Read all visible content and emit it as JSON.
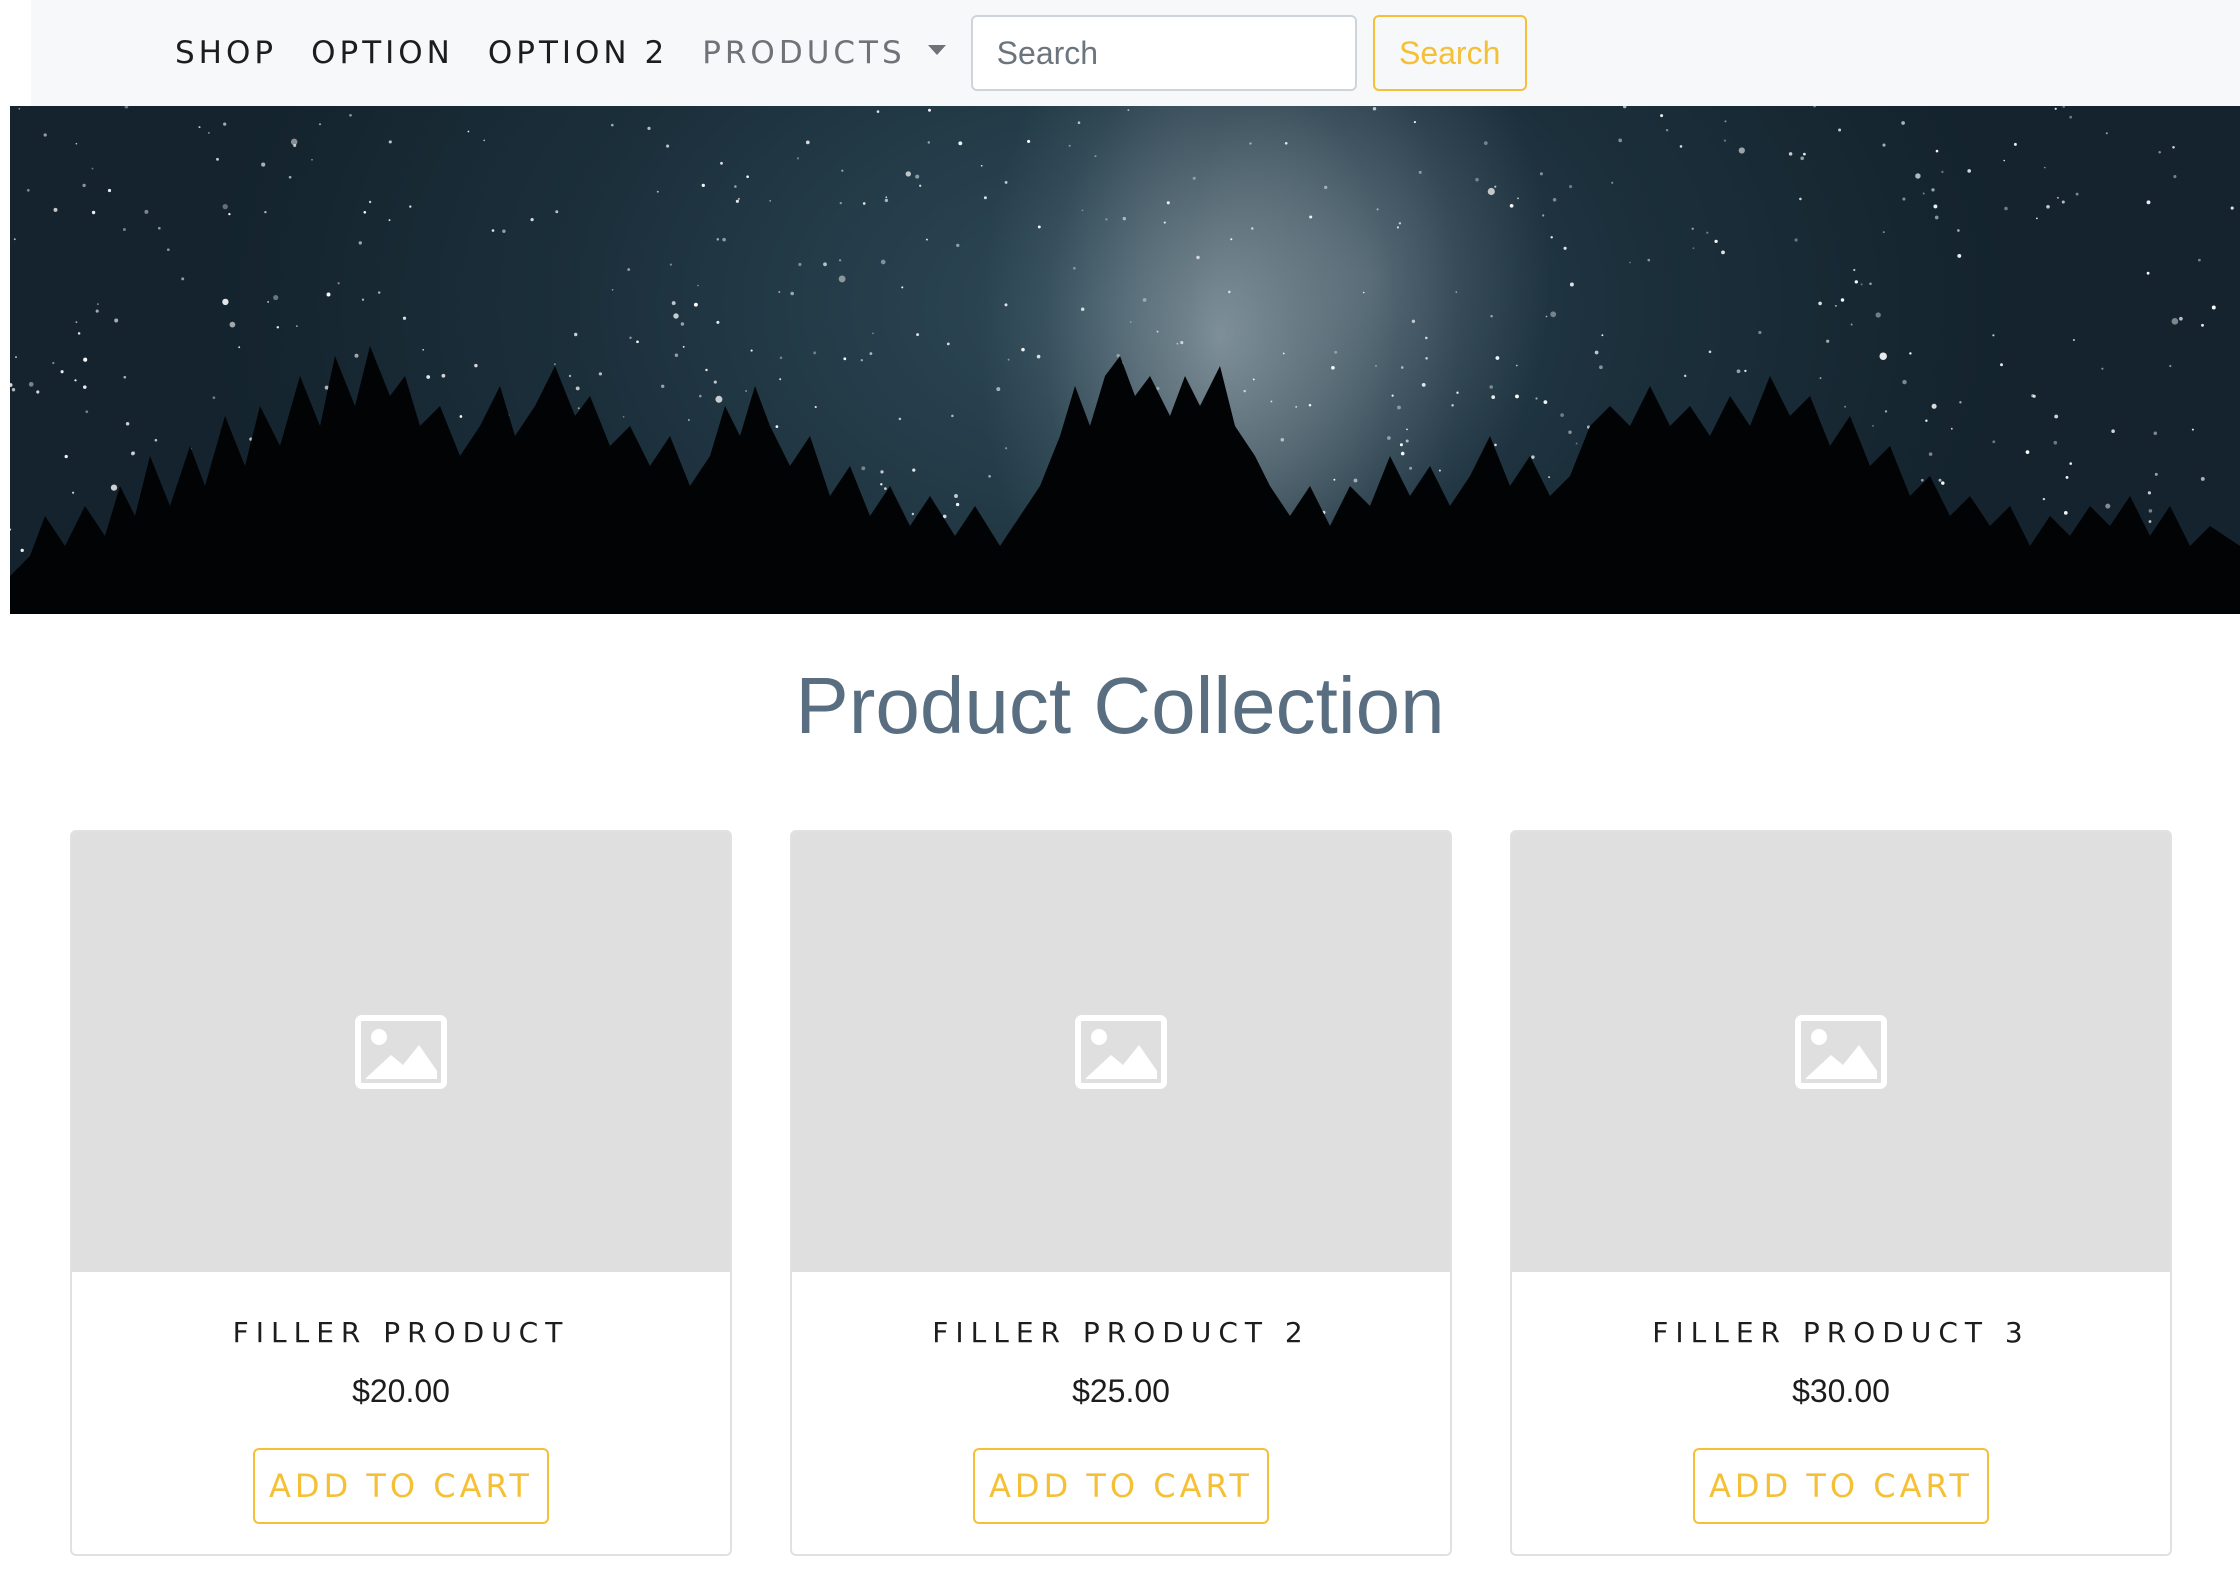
{
  "navbar": {
    "links": [
      "SHOP",
      "OPTION",
      "OPTION 2"
    ],
    "dropdown_label": "PRODUCTS",
    "search": {
      "placeholder": "Search",
      "value": ""
    },
    "search_button": "Search"
  },
  "page_title": "Product Collection",
  "products": [
    {
      "name": "FILLER PRODUCT",
      "price": "$20.00",
      "button": "ADD TO CART"
    },
    {
      "name": "FILLER PRODUCT 2",
      "price": "$25.00",
      "button": "ADD TO CART"
    },
    {
      "name": "FILLER PRODUCT 3",
      "price": "$30.00",
      "button": "ADD TO CART"
    }
  ],
  "icons": {
    "dropdown": "caret-down-icon",
    "product_image": "image-placeholder-icon"
  },
  "colors": {
    "accent": "#f5c036",
    "title": "#596e80",
    "navbar_bg": "#f7f8f9",
    "placeholder_bg": "#dfdfdf"
  }
}
